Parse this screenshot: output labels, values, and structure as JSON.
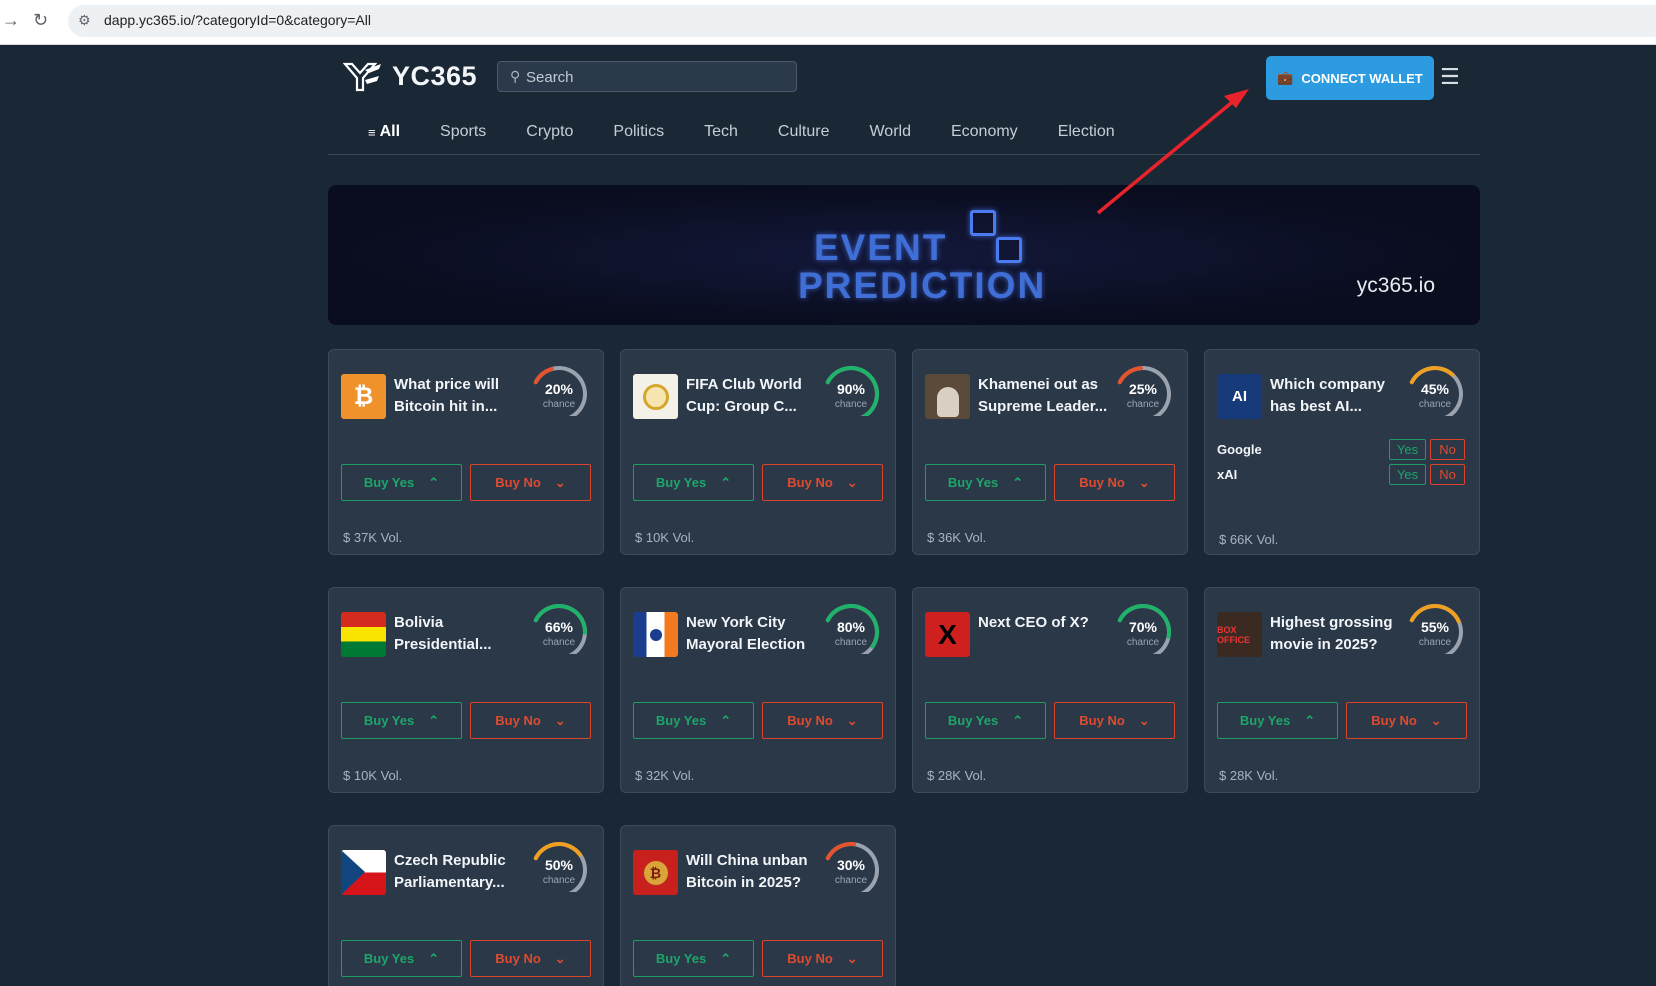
{
  "browser": {
    "back": "→",
    "reload": "↻",
    "url": "dapp.yc365.io/?categoryId=0&category=All"
  },
  "header": {
    "brand": "YC365",
    "search_placeholder": "Search",
    "connect_label": "CONNECT WALLET",
    "accent": "#2c9be0"
  },
  "tabs": [
    {
      "label": "All",
      "active": true
    },
    {
      "label": "Sports"
    },
    {
      "label": "Crypto"
    },
    {
      "label": "Politics"
    },
    {
      "label": "Tech"
    },
    {
      "label": "Culture"
    },
    {
      "label": "World"
    },
    {
      "label": "Economy"
    },
    {
      "label": "Election"
    }
  ],
  "banner": {
    "line1": "EVENT",
    "line2": "PREDICTION",
    "site": "yc365.io"
  },
  "labels": {
    "chance": "chance",
    "buy_yes": "Buy Yes",
    "buy_no": "Buy No",
    "yes": "Yes",
    "no": "No"
  },
  "markets": [
    {
      "title": "What price will Bitcoin hit in...",
      "pct": 20,
      "pct_label": "20%",
      "volume": "$ 37K Vol.",
      "icon": "bitcoin-icon"
    },
    {
      "title": "FIFA Club World Cup: Group C...",
      "pct": 90,
      "pct_label": "90%",
      "volume": "$ 10K Vol.",
      "icon": "fifa-emblem-icon"
    },
    {
      "title": "Khamenei out as Supreme Leader...",
      "pct": 25,
      "pct_label": "25%",
      "volume": "$ 36K Vol.",
      "icon": "portrait-icon"
    },
    {
      "title": "Which company has best AI...",
      "pct": 45,
      "pct_label": "45%",
      "volume": "$ 66K Vol.",
      "icon": "ai-chip-icon",
      "options": [
        {
          "name": "Google"
        },
        {
          "name": "xAI"
        }
      ]
    },
    {
      "title": "Bolivia Presidential...",
      "pct": 66,
      "pct_label": "66%",
      "volume": "$ 10K Vol.",
      "icon": "bolivia-flag-icon"
    },
    {
      "title": "New York City Mayoral Election",
      "pct": 80,
      "pct_label": "80%",
      "volume": "$ 32K Vol.",
      "icon": "nyc-flag-icon"
    },
    {
      "title": "Next CEO of X?",
      "pct": 70,
      "pct_label": "70%",
      "volume": "$ 28K Vol.",
      "icon": "x-logo-icon"
    },
    {
      "title": "Highest grossing movie in 2025?",
      "pct": 55,
      "pct_label": "55%",
      "volume": "$ 28K Vol.",
      "icon": "box-office-icon"
    },
    {
      "title": "Czech Republic Parliamentary...",
      "pct": 50,
      "pct_label": "50%",
      "volume": "",
      "icon": "czech-flag-icon"
    },
    {
      "title": "Will China unban Bitcoin in 2025?",
      "pct": 30,
      "pct_label": "30%",
      "volume": "",
      "icon": "china-bitcoin-icon"
    }
  ],
  "colors": {
    "yes": "#1fa56a",
    "no": "#e04a2e",
    "gauge_low": "#e5532d",
    "gauge_mid": "#f0a021",
    "gauge_high": "#1fb36a",
    "gauge_track": "#9aa3ad",
    "annotation": "#e8232b"
  }
}
